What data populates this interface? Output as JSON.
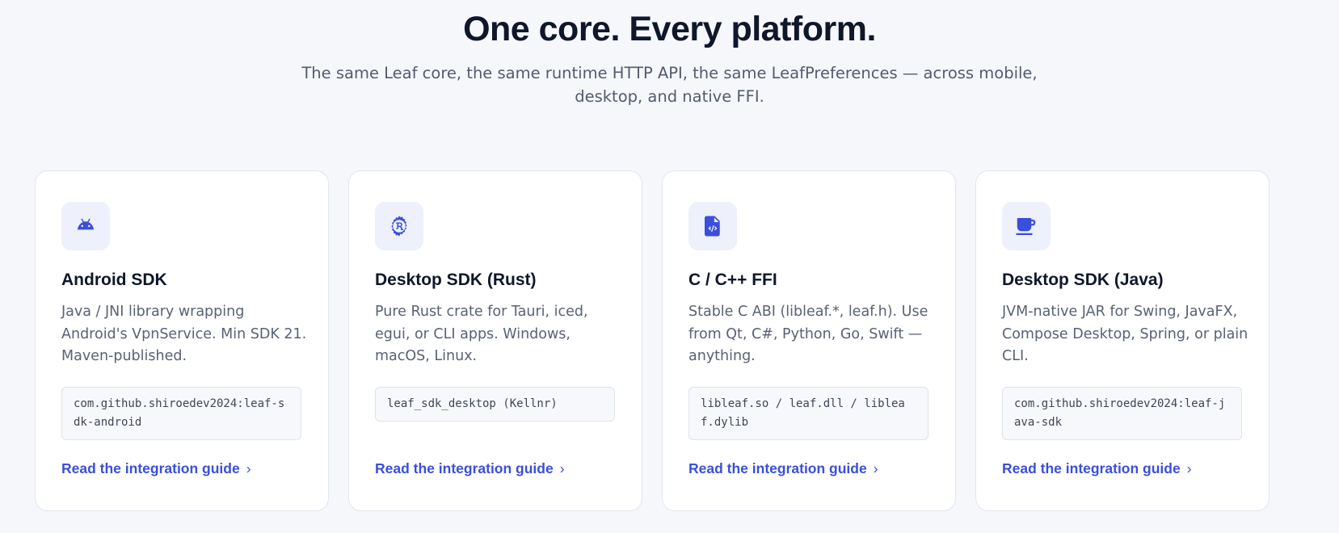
{
  "hero": {
    "title": "One core. Every platform.",
    "subtitle": "The same Leaf core, the same runtime HTTP API, the same LeafPreferences — across mobile, desktop, and native FFI."
  },
  "cards": [
    {
      "icon": "android-icon",
      "title": "Android SDK",
      "description": "Java / JNI library wrapping Android's VpnService. Min SDK 21. Maven-published.",
      "code": "com.github.shiroedev2024:leaf-sdk-android",
      "link": "Read the integration guide"
    },
    {
      "icon": "rust-icon",
      "title": "Desktop SDK (Rust)",
      "description": "Pure Rust crate for Tauri, iced, egui, or CLI apps. Windows, macOS, Linux.",
      "code": "leaf_sdk_desktop (Kellnr)",
      "link": "Read the integration guide"
    },
    {
      "icon": "code-file-icon",
      "title": "C / C++ FFI",
      "description": "Stable C ABI (libleaf.*, leaf.h). Use from Qt, C#, Python, Go, Swift — anything.",
      "code": "libleaf.so / leaf.dll / libleaf.dylib",
      "link": "Read the integration guide"
    },
    {
      "icon": "coffee-cup-icon",
      "title": "Desktop SDK (Java)",
      "description": "JVM-native JAR for Swing, JavaFX, Compose Desktop, Spring, or plain CLI.",
      "code": "com.github.shiroedev2024:leaf-java-sdk",
      "link": "Read the integration guide"
    }
  ],
  "colors": {
    "accent": "#3a4fdc",
    "background": "#f6f7fb",
    "icon_bg": "#eef0fc"
  }
}
